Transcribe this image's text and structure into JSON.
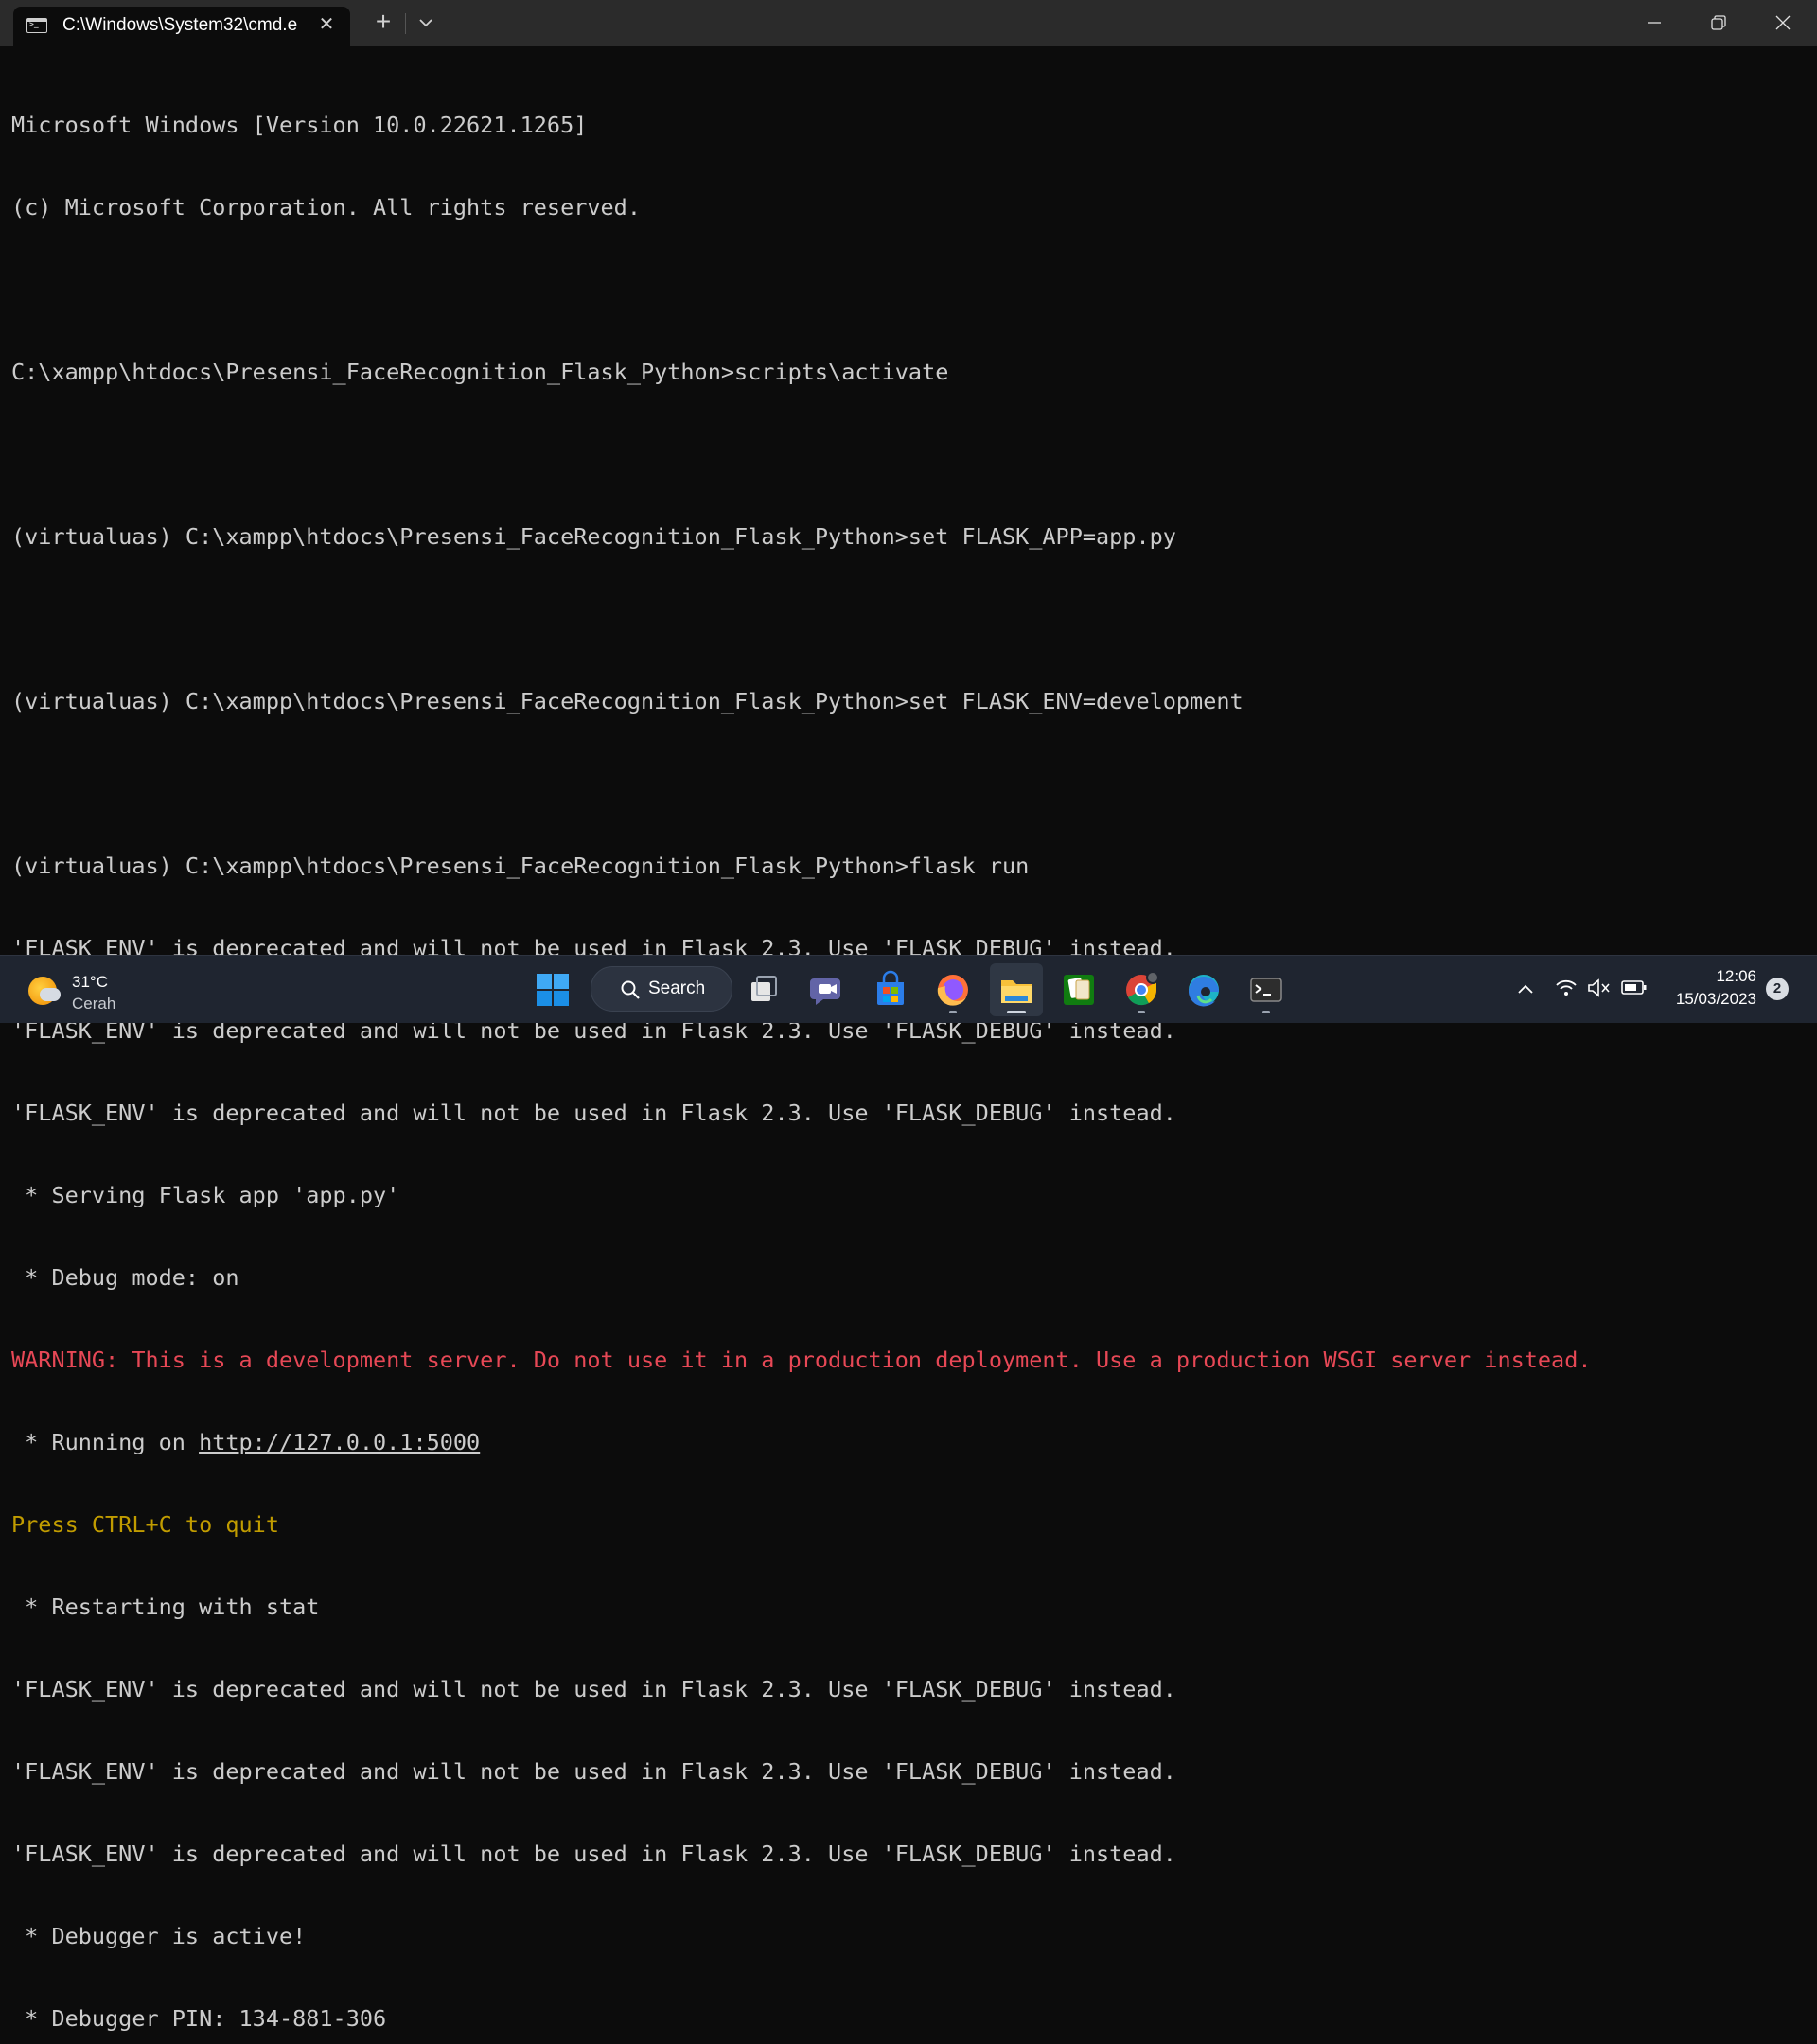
{
  "window": {
    "tab_title": "C:\\Windows\\System32\\cmd.e",
    "new_tab_glyph": "+",
    "close_glyph": "✕"
  },
  "terminal": {
    "lines": [
      "Microsoft Windows [Version 10.0.22621.1265]",
      "(c) Microsoft Corporation. All rights reserved.",
      "",
      "C:\\xampp\\htdocs\\Presensi_FaceRecognition_Flask_Python>scripts\\activate",
      "",
      "(virtualuas) C:\\xampp\\htdocs\\Presensi_FaceRecognition_Flask_Python>set FLASK_APP=app.py",
      "",
      "(virtualuas) C:\\xampp\\htdocs\\Presensi_FaceRecognition_Flask_Python>set FLASK_ENV=development",
      "",
      "(virtualuas) C:\\xampp\\htdocs\\Presensi_FaceRecognition_Flask_Python>flask run",
      "'FLASK_ENV' is deprecated and will not be used in Flask 2.3. Use 'FLASK_DEBUG' instead.",
      "'FLASK_ENV' is deprecated and will not be used in Flask 2.3. Use 'FLASK_DEBUG' instead.",
      "'FLASK_ENV' is deprecated and will not be used in Flask 2.3. Use 'FLASK_DEBUG' instead.",
      " * Serving Flask app 'app.py'",
      " * Debug mode: on",
      "WARNING: This is a development server. Do not use it in a production deployment. Use a production WSGI server instead.",
      " * Running on ",
      "Press CTRL+C to quit",
      " * Restarting with stat",
      "'FLASK_ENV' is deprecated and will not be used in Flask 2.3. Use 'FLASK_DEBUG' instead.",
      "'FLASK_ENV' is deprecated and will not be used in Flask 2.3. Use 'FLASK_DEBUG' instead.",
      "'FLASK_ENV' is deprecated and will not be used in Flask 2.3. Use 'FLASK_DEBUG' instead.",
      " * Debugger is active!",
      " * Debugger PIN: 134-881-306"
    ],
    "running_url": "http://127.0.0.1:5000",
    "colors": {
      "foreground": "#cccccc",
      "background": "#0c0c0c",
      "warning": "#e74856",
      "yellow": "#c19c00"
    }
  },
  "taskbar": {
    "weather": {
      "temp": "31°C",
      "condition": "Cerah"
    },
    "search_label": "Search",
    "apps": [
      "start-icon",
      "task-view-icon",
      "teams-chat-icon",
      "microsoft-store-icon",
      "firefox-icon",
      "file-explorer-icon",
      "solitaire-icon",
      "chrome-icon",
      "edge-icon",
      "terminal-icon"
    ],
    "clock": {
      "time": "12:06",
      "date": "15/03/2023"
    },
    "notification_count": "2"
  }
}
